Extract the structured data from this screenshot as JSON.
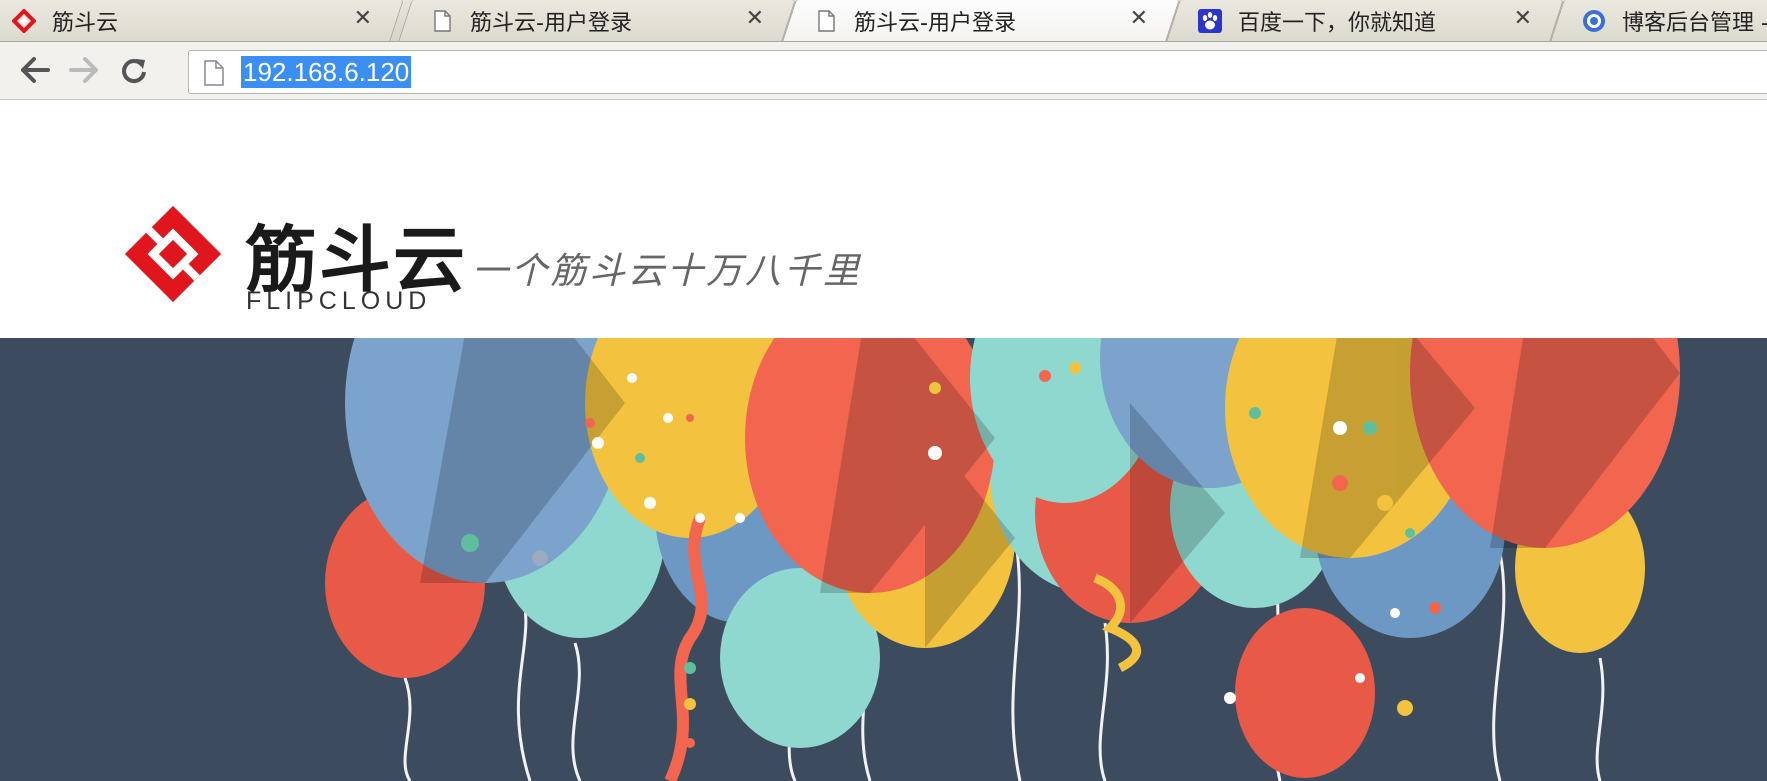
{
  "browser": {
    "tabs": [
      {
        "title": "筋斗云",
        "favicon": "flipcloud-logo-icon",
        "active": false
      },
      {
        "title": "筋斗云-用户登录",
        "favicon": "page-icon",
        "active": false
      },
      {
        "title": "筋斗云-用户登录",
        "favicon": "page-icon",
        "active": true
      },
      {
        "title": "百度一下，你就知道",
        "favicon": "baidu-paw-icon",
        "active": false
      },
      {
        "title": "博客后台管理 -",
        "favicon": "blog-icon",
        "active": false
      }
    ],
    "close_glyph": "✕",
    "address": "192.168.6.120"
  },
  "page": {
    "logo_cn": "筋斗云",
    "logo_en": "FLIPCLOUD",
    "slogan": "一个筋斗云十万八千里",
    "brand_color": "#e0161e",
    "banner_bg": "#3c4c5e"
  }
}
